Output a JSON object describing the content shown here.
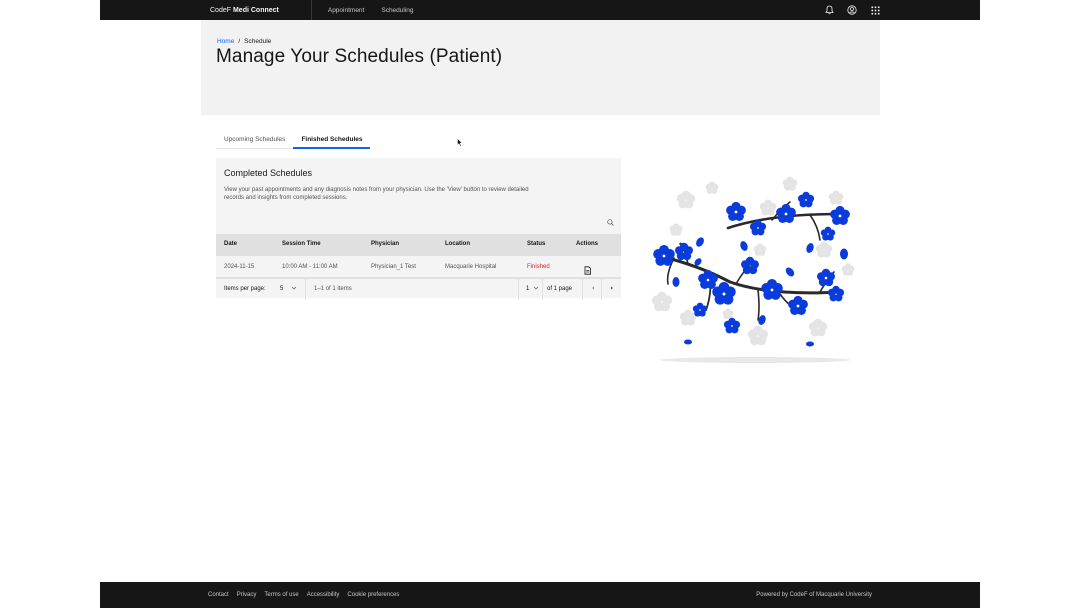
{
  "header": {
    "brand_prefix": "CodeF",
    "brand_name": "Medi Connect",
    "nav": [
      "Appointment",
      "Scheduling"
    ],
    "icons": [
      "notification-icon",
      "user-avatar-icon",
      "app-switcher-icon"
    ]
  },
  "breadcrumb": {
    "home": "Home",
    "separator": "/",
    "current": "Schedule"
  },
  "page": {
    "title": "Manage Your Schedules (Patient)"
  },
  "tabs": [
    {
      "label": "Upcoming Schedules",
      "active": false
    },
    {
      "label": "Finished Schedules",
      "active": true
    }
  ],
  "table": {
    "title": "Completed Schedules",
    "description": "View your past appointments and any diagnosis notes from your physician. Use the 'View' button to review detailed records and insights from completed sessions.",
    "columns": [
      "Date",
      "Session Time",
      "Physician",
      "Location",
      "Status",
      "Actions"
    ],
    "rows": [
      {
        "date": "2024-11-15",
        "session_time": "10:00 AM - 11:00 AM",
        "physician": "Physician_1 Test",
        "location": "Macquarie Hospital",
        "status": "Finished"
      }
    ],
    "pagination": {
      "items_per_page_label": "Items per page:",
      "items_per_page": "5",
      "range": "1–1 of 1 items",
      "page": "1",
      "of_pages": "of 1 page"
    }
  },
  "footer": {
    "links": [
      "Contact",
      "Privacy",
      "Terms of use",
      "Accessibility",
      "Cookie preferences"
    ],
    "powered_by": "Powered by CodeF of Macquarie University"
  },
  "colors": {
    "accent": "#0f62fe",
    "header_bg": "#161616",
    "status_finished": "#da1e28",
    "flower_blue": "#0a3bdb"
  }
}
